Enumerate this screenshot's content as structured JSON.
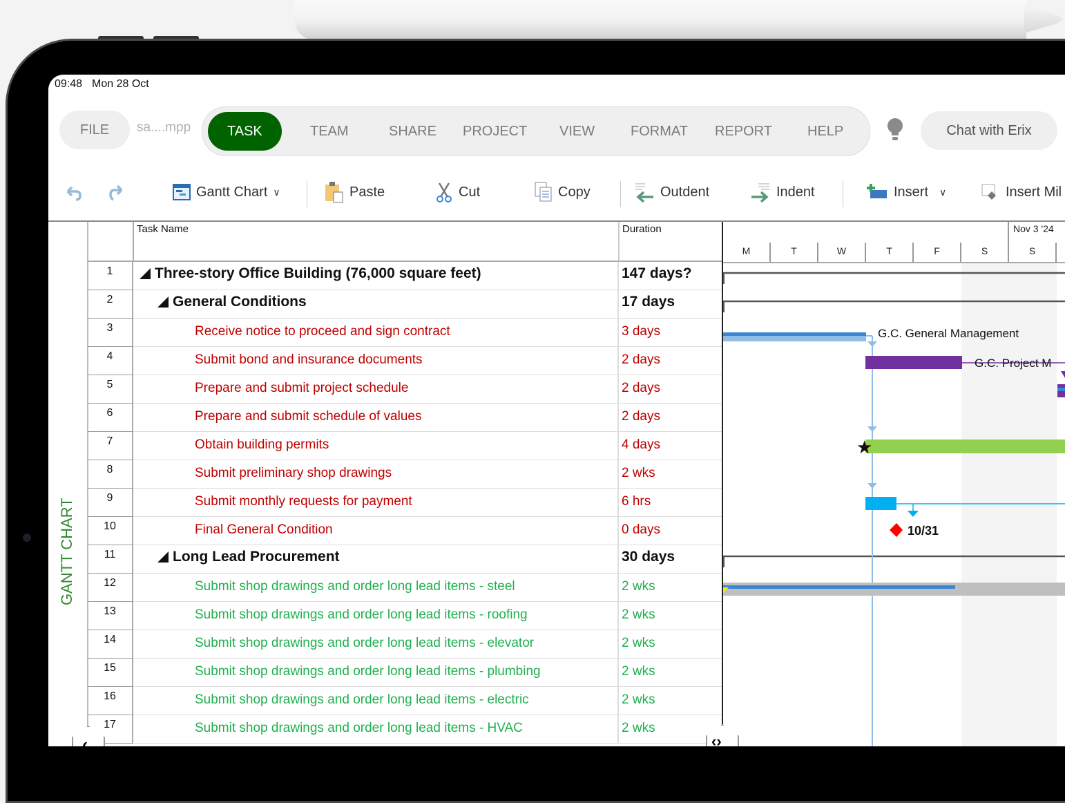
{
  "status_bar": {
    "time": "09:48",
    "date": "Mon 28 Oct"
  },
  "header": {
    "file_label": "FILE",
    "file_name": "sa....mpp",
    "tabs": [
      {
        "label": "TASK",
        "active": true
      },
      {
        "label": "TEAM",
        "active": false
      },
      {
        "label": "SHARE",
        "active": false
      },
      {
        "label": "PROJECT",
        "active": false
      },
      {
        "label": "VIEW",
        "active": false
      },
      {
        "label": "FORMAT",
        "active": false
      },
      {
        "label": "REPORT",
        "active": false
      },
      {
        "label": "HELP",
        "active": false
      }
    ],
    "tips_icon": "lightbulb-icon",
    "chat_label": "Chat with Erix",
    "accent_color": "#006300"
  },
  "toolbar": {
    "undo_icon": "undo-icon",
    "redo_icon": "redo-icon",
    "view_label": "Gantt Chart",
    "paste_label": "Paste",
    "cut_label": "Cut",
    "copy_label": "Copy",
    "outdent_label": "Outdent",
    "indent_label": "Indent",
    "insert_label": "Insert",
    "insert_milestone_label": "Insert Mil"
  },
  "sidebar": {
    "view_label": "GANTT CHART"
  },
  "table": {
    "columns": [
      "Task Name",
      "Duration"
    ],
    "rows": [
      {
        "id": "1",
        "name": "Three-story Office Building (76,000 square feet)",
        "duration": "147 days?",
        "level": 0,
        "summary": true,
        "color": "black"
      },
      {
        "id": "2",
        "name": "General Conditions",
        "duration": "17 days",
        "level": 1,
        "summary": true,
        "color": "black"
      },
      {
        "id": "3",
        "name": "Receive notice to proceed and sign contract",
        "duration": "3 days",
        "level": 2,
        "summary": false,
        "color": "red"
      },
      {
        "id": "4",
        "name": "Submit bond and insurance documents",
        "duration": "2 days",
        "level": 2,
        "summary": false,
        "color": "red"
      },
      {
        "id": "5",
        "name": "Prepare and submit project schedule",
        "duration": "2 days",
        "level": 2,
        "summary": false,
        "color": "red"
      },
      {
        "id": "6",
        "name": "Prepare and submit schedule of values",
        "duration": "2 days",
        "level": 2,
        "summary": false,
        "color": "red"
      },
      {
        "id": "7",
        "name": "Obtain building permits",
        "duration": "4 days",
        "level": 2,
        "summary": false,
        "color": "red"
      },
      {
        "id": "8",
        "name": "Submit preliminary shop drawings",
        "duration": "2 wks",
        "level": 2,
        "summary": false,
        "color": "red"
      },
      {
        "id": "9",
        "name": "Submit monthly requests for payment",
        "duration": "6 hrs",
        "level": 2,
        "summary": false,
        "color": "red"
      },
      {
        "id": "10",
        "name": "Final General Condition",
        "duration": "0 days",
        "level": 2,
        "summary": false,
        "color": "red"
      },
      {
        "id": "11",
        "name": "Long Lead Procurement",
        "duration": "30 days",
        "level": 1,
        "summary": true,
        "color": "black"
      },
      {
        "id": "12",
        "name": "Submit shop drawings and order long lead items - steel",
        "duration": "2 wks",
        "level": 2,
        "summary": false,
        "color": "green"
      },
      {
        "id": "13",
        "name": "Submit shop drawings and order long lead items - roofing",
        "duration": "2 wks",
        "level": 2,
        "summary": false,
        "color": "green"
      },
      {
        "id": "14",
        "name": "Submit shop drawings and order long lead items - elevator",
        "duration": "2 wks",
        "level": 2,
        "summary": false,
        "color": "green"
      },
      {
        "id": "15",
        "name": "Submit shop drawings and order long lead items - plumbing",
        "duration": "2 wks",
        "level": 2,
        "summary": false,
        "color": "green"
      },
      {
        "id": "16",
        "name": "Submit shop drawings and order long lead items - electric",
        "duration": "2 wks",
        "level": 2,
        "summary": false,
        "color": "green"
      },
      {
        "id": "17",
        "name": "Submit shop drawings and order long lead items - HVAC",
        "duration": "2 wks",
        "level": 2,
        "summary": false,
        "color": "green"
      }
    ]
  },
  "gantt": {
    "week_label": "Nov 3 '24",
    "days": [
      "M",
      "T",
      "W",
      "T",
      "F",
      "S",
      "S"
    ],
    "bar_labels": {
      "row3": "G.C. General Management",
      "row4": "G.C. Project M",
      "row10": "10/31"
    },
    "colors": {
      "row3": "#3a86d6",
      "row4": "#7030a0",
      "row7": "#92d050",
      "row9": "#00b0f0",
      "milestone": "#ff0000",
      "row12": "#bfbfbf"
    }
  }
}
